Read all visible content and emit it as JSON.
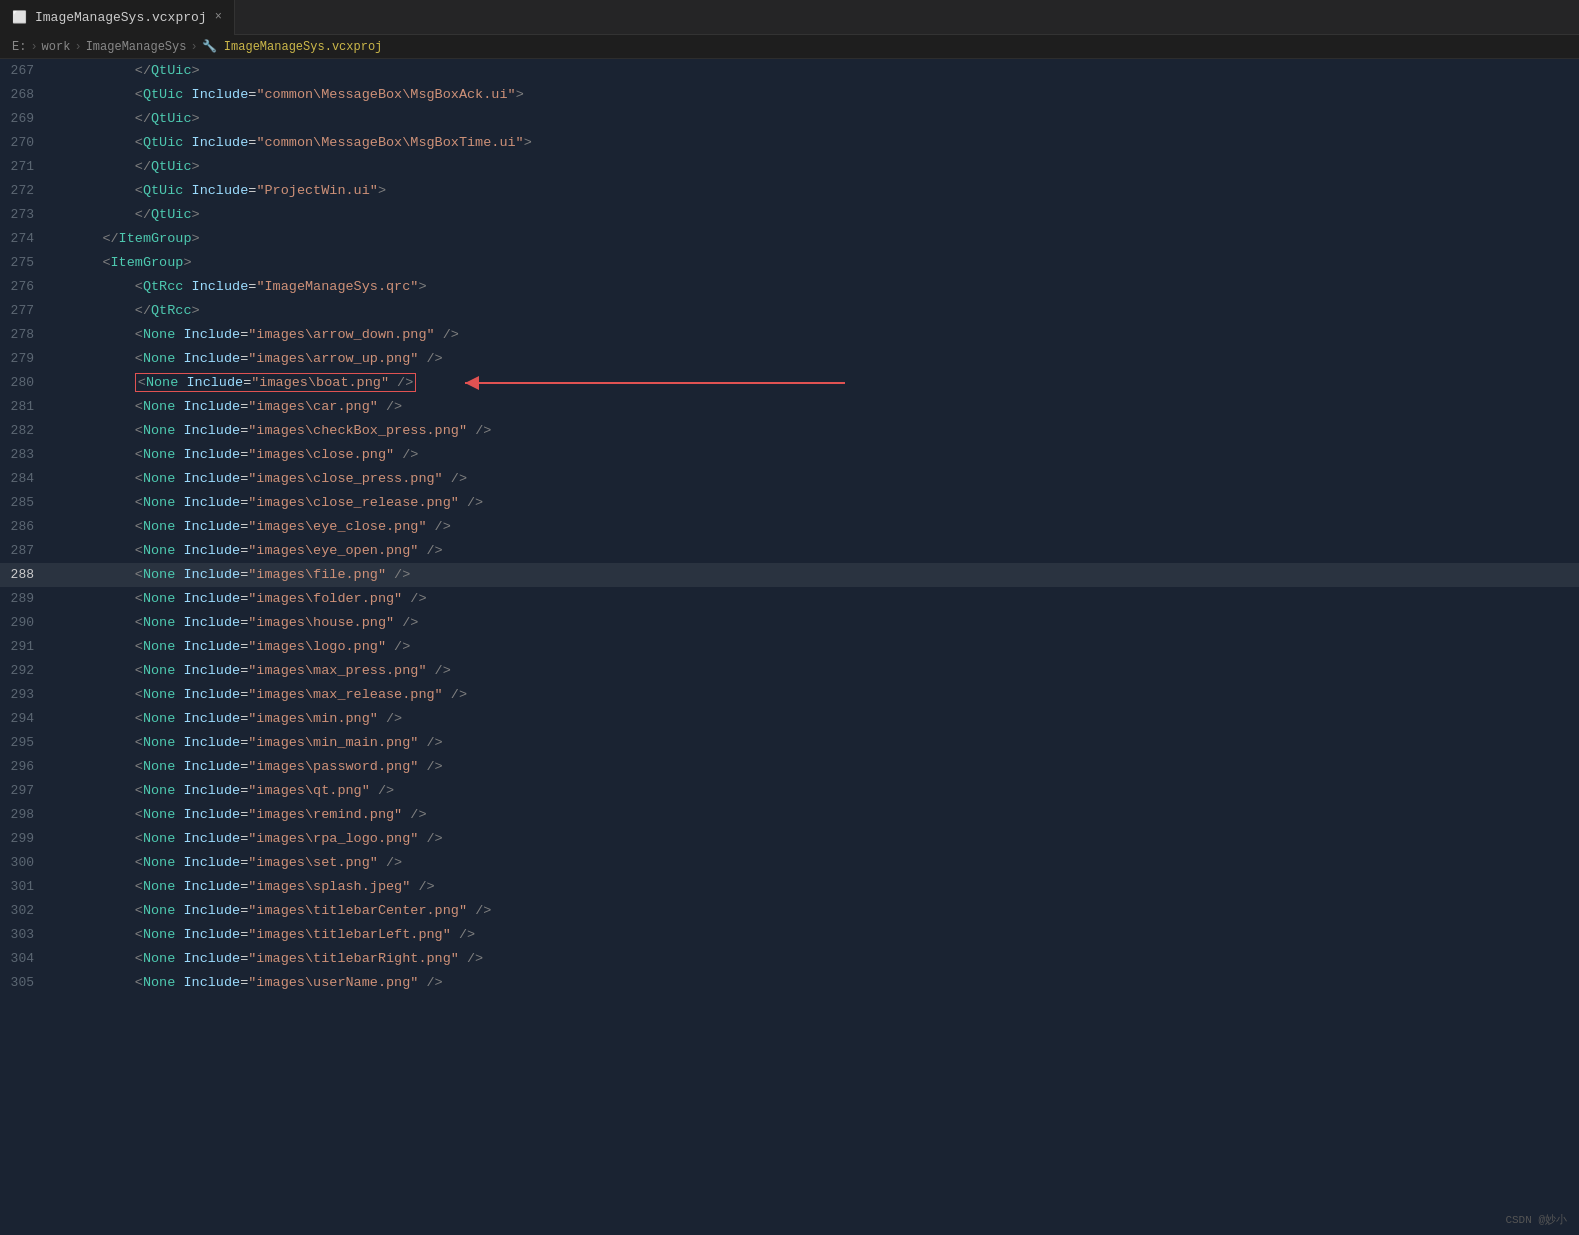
{
  "titleBar": {
    "tab": {
      "label": "ImageManageSys.vcxproj",
      "icon": "📄",
      "closeLabel": "×"
    }
  },
  "breadcrumb": {
    "items": [
      {
        "label": "E:",
        "type": "text"
      },
      {
        "label": ">",
        "type": "sep"
      },
      {
        "label": "work",
        "type": "text"
      },
      {
        "label": ">",
        "type": "sep"
      },
      {
        "label": "ImageManageSys",
        "type": "text"
      },
      {
        "label": ">",
        "type": "sep"
      },
      {
        "label": "ImageManageSys.vcxproj",
        "type": "icon-item"
      }
    ]
  },
  "lines": [
    {
      "num": "267",
      "content": "        </QtUic>",
      "type": "close-tag",
      "tagName": "QtUic"
    },
    {
      "num": "268",
      "content": "        <QtUic Include=\"common\\MessageBox\\MsgBoxAck.ui\">",
      "type": "open-tag-attr",
      "tagName": "QtUic",
      "attrName": "Include",
      "attrVal": "\"common\\MessageBox\\MsgBoxAck.ui\""
    },
    {
      "num": "269",
      "content": "        </QtUic>",
      "type": "close-tag",
      "tagName": "QtUic"
    },
    {
      "num": "270",
      "content": "        <QtUic Include=\"common\\MessageBox\\MsgBoxTime.ui\">",
      "type": "open-tag-attr",
      "tagName": "QtUic",
      "attrName": "Include",
      "attrVal": "\"common\\MessageBox\\MsgBoxTime.ui\""
    },
    {
      "num": "271",
      "content": "        </QtUic>",
      "type": "close-tag",
      "tagName": "QtUic"
    },
    {
      "num": "272",
      "content": "        <QtUic Include=\"ProjectWin.ui\">",
      "type": "open-tag-attr",
      "tagName": "QtUic",
      "attrName": "Include",
      "attrVal": "\"ProjectWin.ui\""
    },
    {
      "num": "273",
      "content": "        </QtUic>",
      "type": "close-tag",
      "tagName": "QtUic"
    },
    {
      "num": "274",
      "content": "    </ItemGroup>",
      "type": "close-tag",
      "tagName": "ItemGroup"
    },
    {
      "num": "275",
      "content": "    <ItemGroup>",
      "type": "open-tag",
      "tagName": "ItemGroup"
    },
    {
      "num": "276",
      "content": "        <QtRcc Include=\"ImageManageSys.qrc\">",
      "type": "open-tag-attr",
      "tagName": "QtRcc",
      "attrName": "Include",
      "attrVal": "\"ImageManageSys.qrc\""
    },
    {
      "num": "277",
      "content": "        </QtRcc>",
      "type": "close-tag",
      "tagName": "QtRcc"
    },
    {
      "num": "278",
      "content": "        <None Include=\"images\\arrow_down.png\" />",
      "type": "self-close",
      "tagName": "None",
      "attrName": "Include",
      "attrVal": "\"images\\arrow_down.png\""
    },
    {
      "num": "279",
      "content": "        <None Include=\"images\\arrow_up.png\" />",
      "type": "self-close",
      "tagName": "None",
      "attrName": "Include",
      "attrVal": "\"images\\arrow_up.png\""
    },
    {
      "num": "280",
      "content": "        <None Include=\"images\\boat.png\" />",
      "type": "self-close",
      "tagName": "None",
      "attrName": "Include",
      "attrVal": "\"images\\boat.png\"",
      "isArrow": true
    },
    {
      "num": "281",
      "content": "        <None Include=\"images\\car.png\" />",
      "type": "self-close",
      "tagName": "None",
      "attrName": "Include",
      "attrVal": "\"images\\car.png\""
    },
    {
      "num": "282",
      "content": "        <None Include=\"images\\checkBox_press.png\" />",
      "type": "self-close",
      "tagName": "None",
      "attrName": "Include",
      "attrVal": "\"images\\checkBox_press.png\""
    },
    {
      "num": "283",
      "content": "        <None Include=\"images\\close.png\" />",
      "type": "self-close",
      "tagName": "None",
      "attrName": "Include",
      "attrVal": "\"images\\close.png\""
    },
    {
      "num": "284",
      "content": "        <None Include=\"images\\close_press.png\" />",
      "type": "self-close",
      "tagName": "None",
      "attrName": "Include",
      "attrVal": "\"images\\close_press.png\""
    },
    {
      "num": "285",
      "content": "        <None Include=\"images\\close_release.png\" />",
      "type": "self-close",
      "tagName": "None",
      "attrName": "Include",
      "attrVal": "\"images\\close_release.png\""
    },
    {
      "num": "286",
      "content": "        <None Include=\"images\\eye_close.png\" />",
      "type": "self-close",
      "tagName": "None",
      "attrName": "Include",
      "attrVal": "\"images\\eye_close.png\""
    },
    {
      "num": "287",
      "content": "        <None Include=\"images\\eye_open.png\" />",
      "type": "self-close",
      "tagName": "None",
      "attrName": "Include",
      "attrVal": "\"images\\eye_open.png\""
    },
    {
      "num": "288",
      "content": "        <None Include=\"images\\file.png\" />",
      "type": "self-close",
      "tagName": "None",
      "attrName": "Include",
      "attrVal": "\"images\\file.png\"",
      "isHighlighted": true
    },
    {
      "num": "289",
      "content": "        <None Include=\"images\\folder.png\" />",
      "type": "self-close",
      "tagName": "None",
      "attrName": "Include",
      "attrVal": "\"images\\folder.png\""
    },
    {
      "num": "290",
      "content": "        <None Include=\"images\\house.png\" />",
      "type": "self-close",
      "tagName": "None",
      "attrName": "Include",
      "attrVal": "\"images\\house.png\""
    },
    {
      "num": "291",
      "content": "        <None Include=\"images\\logo.png\" />",
      "type": "self-close",
      "tagName": "None",
      "attrName": "Include",
      "attrVal": "\"images\\logo.png\""
    },
    {
      "num": "292",
      "content": "        <None Include=\"images\\max_press.png\" />",
      "type": "self-close",
      "tagName": "None",
      "attrName": "Include",
      "attrVal": "\"images\\max_press.png\""
    },
    {
      "num": "293",
      "content": "        <None Include=\"images\\max_release.png\" />",
      "type": "self-close",
      "tagName": "None",
      "attrName": "Include",
      "attrVal": "\"images\\max_release.png\""
    },
    {
      "num": "294",
      "content": "        <None Include=\"images\\min.png\" />",
      "type": "self-close",
      "tagName": "None",
      "attrName": "Include",
      "attrVal": "\"images\\min.png\""
    },
    {
      "num": "295",
      "content": "        <None Include=\"images\\min_main.png\" />",
      "type": "self-close",
      "tagName": "None",
      "attrName": "Include",
      "attrVal": "\"images\\min_main.png\""
    },
    {
      "num": "296",
      "content": "        <None Include=\"images\\password.png\" />",
      "type": "self-close",
      "tagName": "None",
      "attrName": "Include",
      "attrVal": "\"images\\password.png\""
    },
    {
      "num": "297",
      "content": "        <None Include=\"images\\qt.png\" />",
      "type": "self-close",
      "tagName": "None",
      "attrName": "Include",
      "attrVal": "\"images\\qt.png\""
    },
    {
      "num": "298",
      "content": "        <None Include=\"images\\remind.png\" />",
      "type": "self-close",
      "tagName": "None",
      "attrName": "Include",
      "attrVal": "\"images\\remind.png\""
    },
    {
      "num": "299",
      "content": "        <None Include=\"images\\rpa_logo.png\" />",
      "type": "self-close",
      "tagName": "None",
      "attrName": "Include",
      "attrVal": "\"images\\rpa_logo.png\""
    },
    {
      "num": "300",
      "content": "        <None Include=\"images\\set.png\" />",
      "type": "self-close",
      "tagName": "None",
      "attrName": "Include",
      "attrVal": "\"images\\set.png\""
    },
    {
      "num": "301",
      "content": "        <None Include=\"images\\splash.jpeg\" />",
      "type": "self-close",
      "tagName": "None",
      "attrName": "Include",
      "attrVal": "\"images\\splash.jpeg\""
    },
    {
      "num": "302",
      "content": "        <None Include=\"images\\titlebarCenter.png\" />",
      "type": "self-close",
      "tagName": "None",
      "attrName": "Include",
      "attrVal": "\"images\\titlebarCenter.png\""
    },
    {
      "num": "303",
      "content": "        <None Include=\"images\\titlebarLeft.png\" />",
      "type": "self-close",
      "tagName": "None",
      "attrName": "Include",
      "attrVal": "\"images\\titlebarLeft.png\""
    },
    {
      "num": "304",
      "content": "        <None Include=\"images\\titlebarRight.png\" />",
      "type": "self-close",
      "tagName": "None",
      "attrName": "Include",
      "attrVal": "\"images\\titlebarRight.png\""
    },
    {
      "num": "305",
      "content": "        <None Include=\"images\\userName.png\" />",
      "type": "self-close",
      "tagName": "None",
      "attrName": "Include",
      "attrVal": "\"images\\userName.png\""
    }
  ],
  "watermark": "CSDN @妙小"
}
